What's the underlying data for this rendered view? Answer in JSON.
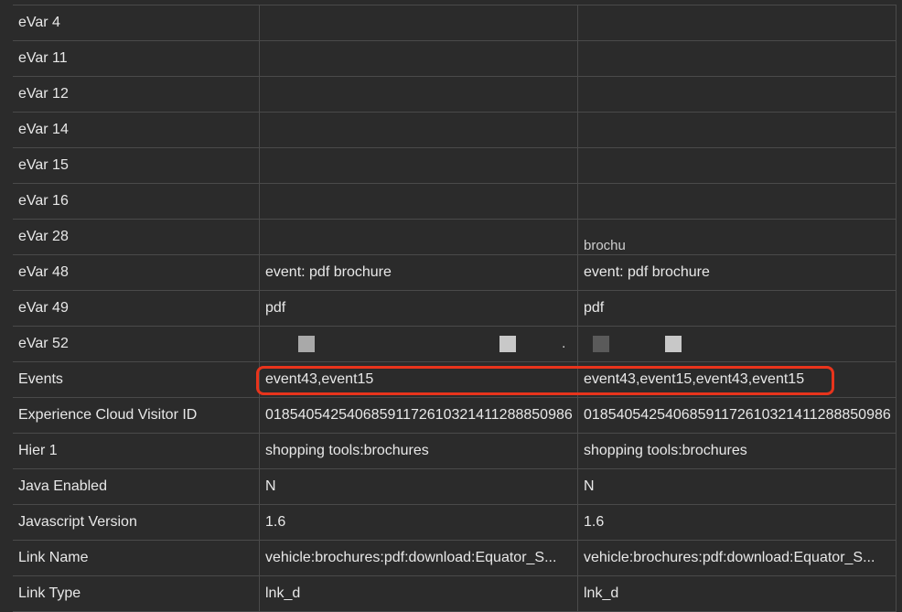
{
  "rows": [
    {
      "name": "eVar 4",
      "v1": "",
      "v2": ""
    },
    {
      "name": "eVar 11",
      "v1": "",
      "v2": ""
    },
    {
      "name": "eVar 12",
      "v1": "",
      "v2": ""
    },
    {
      "name": "eVar 14",
      "v1": "",
      "v2": ""
    },
    {
      "name": "eVar 15",
      "v1": "",
      "v2": ""
    },
    {
      "name": "eVar 16",
      "v1": "",
      "v2": ""
    },
    {
      "name": "eVar 28",
      "v1": "",
      "v2": "brochu"
    },
    {
      "name": "eVar 48",
      "v1": "event: pdf brochure",
      "v2": "event: pdf brochure"
    },
    {
      "name": "eVar 49",
      "v1": "pdf",
      "v2": "pdf"
    },
    {
      "name": "eVar 52",
      "v1": "",
      "v2": ""
    },
    {
      "name": "Events",
      "v1": "event43,event15",
      "v2": "event43,event15,event43,event15"
    },
    {
      "name": "Experience Cloud Visitor ID",
      "v1": "01854054254068591172610321411288850986",
      "v2": "01854054254068591172610321411288850986"
    },
    {
      "name": "Hier 1",
      "v1": "shopping tools:brochures",
      "v2": "shopping tools:brochures"
    },
    {
      "name": "Java Enabled",
      "v1": "N",
      "v2": "N"
    },
    {
      "name": "Javascript Version",
      "v1": "1.6",
      "v2": "1.6"
    },
    {
      "name": "Link Name",
      "v1": "vehicle:brochures:pdf:download:Equator_S...",
      "v2": "vehicle:brochures:pdf:download:Equator_S..."
    },
    {
      "name": "Link Type",
      "v1": "lnk_d",
      "v2": "lnk_d"
    }
  ],
  "swatch_colors": {
    "light": "#a9a9a9",
    "lighter": "#c8c8c8",
    "dark": "#5a5a5a",
    "highlight_border": "#e8341c"
  }
}
